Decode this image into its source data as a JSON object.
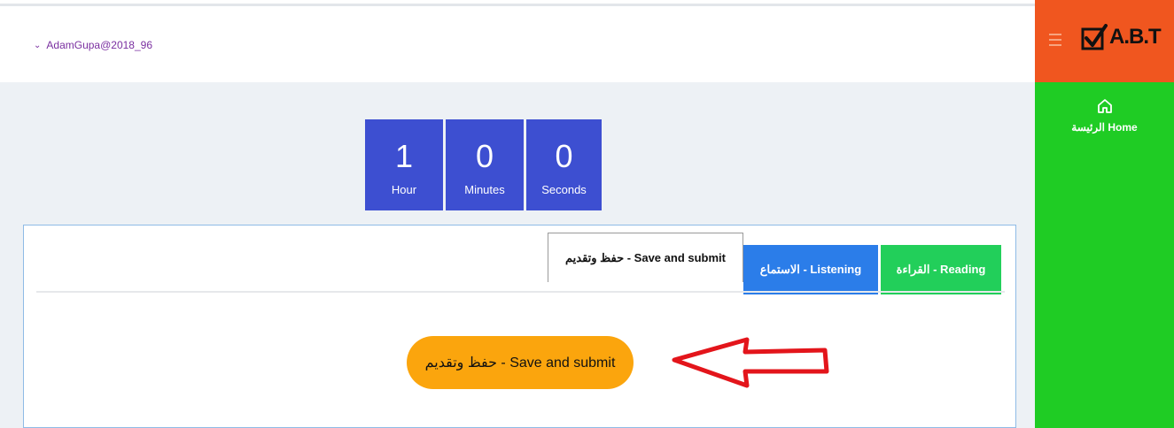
{
  "header": {
    "username": "AdamGupa@2018_96"
  },
  "timer": {
    "hours": "1",
    "hours_label": "Hour",
    "minutes": "0",
    "minutes_label": "Minutes",
    "seconds": "0",
    "seconds_label": "Seconds",
    "box_color": "#3d4fd1"
  },
  "tabs": [
    {
      "label": "حفظ وتقديم - Save and submit",
      "active": true
    },
    {
      "label": "الاستماع - Listening",
      "color": "#2b7de9"
    },
    {
      "label": "القراءة - Reading",
      "color": "#22cf5a"
    }
  ],
  "main": {
    "submit_label": "حفظ وتقديم - Save and submit",
    "submit_color": "#fba50d"
  },
  "sidebar": {
    "brand": "A.B.T",
    "brand_color": "#f0561f",
    "home_label": "الرئيسة Home",
    "color": "#1fcc24"
  },
  "icons": {
    "menu": "hamburger-icon",
    "logo": "checkbox-icon",
    "home": "home-icon",
    "arrow": "left-arrow-icon"
  }
}
